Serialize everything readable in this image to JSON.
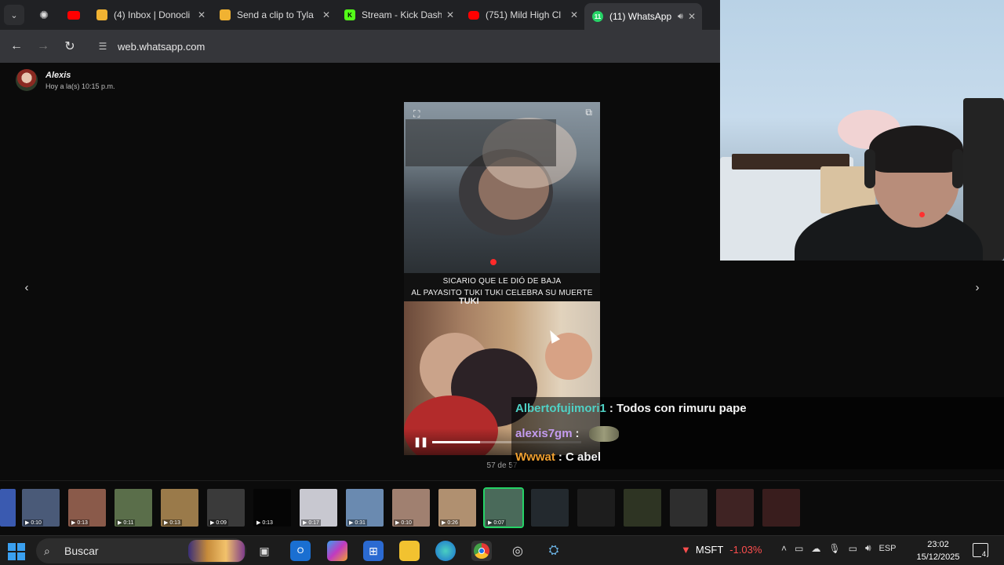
{
  "browser": {
    "tabs": [
      {
        "title": "(4) Inbox | Donocli",
        "favicon": "#f0b232",
        "x": 0
      },
      {
        "title": "Send a clip to Tyla",
        "favicon": "#f0b232"
      },
      {
        "title": "Stream - Kick Dash",
        "favicon": "#53fc18"
      },
      {
        "title": "(751) Mild High Cl",
        "favicon": "#ff0000"
      },
      {
        "title": "(11) WhatsApp",
        "favicon": "#25d366"
      }
    ],
    "url": "web.whatsapp.com"
  },
  "viewer": {
    "sender_name": "Alexis",
    "sender_time": "Hoy a la(s) 10:15 p.m.",
    "counter": "57 de 57",
    "video": {
      "caption_line1": "SICARIO QUE LE DIÓ DE BAJA",
      "caption_line2": "AL PAYASITO TUKI TUKI CELEBRA SU MUERTE",
      "progress": 0.32,
      "overlay_label": "TUKI"
    }
  },
  "stream_chat": [
    {
      "user": "Albertofujimori1",
      "sep": ":",
      "text": "Todos con rimuru pape",
      "color": "#4fd1c5"
    },
    {
      "user": "alexis7gm",
      "sep": ":",
      "text": "",
      "color": "#c39bef"
    },
    {
      "user": "Wwwat",
      "sep": ":",
      "text": "C abel",
      "color": "#f0a030"
    }
  ],
  "thumbnails": [
    {
      "dur": "0:10",
      "color": "#4a5a78"
    },
    {
      "dur": "0:13",
      "color": "#8a5a4a"
    },
    {
      "dur": "0:11",
      "color": "#5a6e4a"
    },
    {
      "dur": "0:13",
      "color": "#9a7a4a"
    },
    {
      "dur": "0:09",
      "color": "#3a3a3a"
    },
    {
      "dur": "0:13",
      "color": "#050505"
    },
    {
      "dur": "0:17",
      "color": "#c8c8d0"
    },
    {
      "dur": "0:31",
      "color": "#6a8ab0"
    },
    {
      "dur": "0:10",
      "color": "#a08070"
    },
    {
      "dur": "0:26",
      "color": "#b09070"
    },
    {
      "dur": "0:07",
      "color": "#4a6a5a"
    },
    {
      "dur": "",
      "color": "#506070"
    },
    {
      "dur": "",
      "color": "#404040"
    },
    {
      "dur": "",
      "color": "#708050"
    },
    {
      "dur": "",
      "color": "#707070"
    },
    {
      "dur": "",
      "color": "#a05050"
    },
    {
      "dur": "",
      "color": "#904040"
    }
  ],
  "taskbar": {
    "search_label": "Buscar",
    "ticker_symbol": "MSFT",
    "ticker_change": "-1.03%",
    "language": "ESP",
    "time": "23:02",
    "date": "15/12/2025",
    "notifications": "4"
  }
}
